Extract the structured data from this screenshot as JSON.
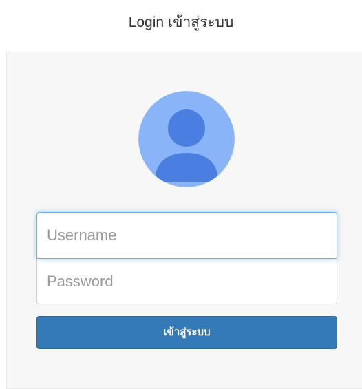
{
  "header": {
    "title": "Login เข้าสู่ระบบ"
  },
  "form": {
    "username": {
      "value": "",
      "placeholder": "Username"
    },
    "password": {
      "value": "",
      "placeholder": "Password"
    },
    "submit_label": "เข้าสู่ระบบ"
  },
  "avatar": {
    "icon": "user-icon"
  },
  "colors": {
    "accent": "#337ab7",
    "avatar_bg": "#8ab4f8",
    "avatar_figure": "#4a7fe0",
    "focus_border": "#66afe9",
    "card_bg": "#f7f7f7"
  }
}
